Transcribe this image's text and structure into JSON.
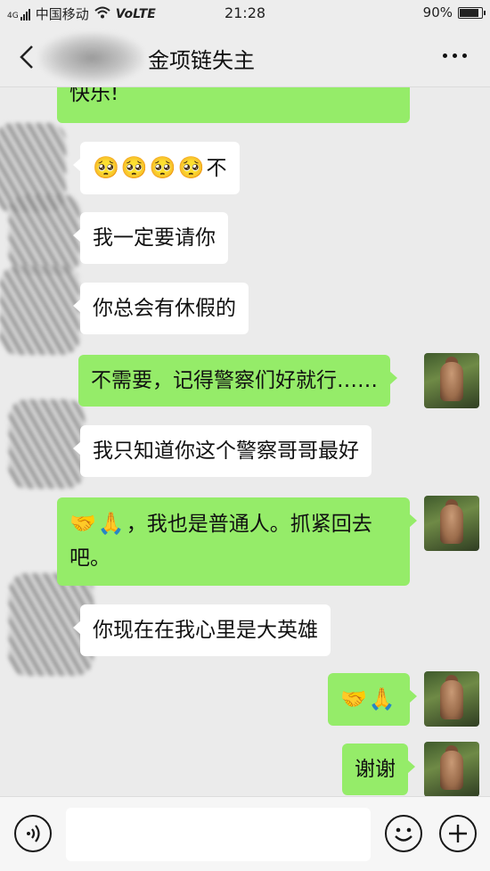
{
  "status_bar": {
    "network_type": "4G",
    "carrier": "中国移动",
    "volte": "VoLTE",
    "time": "21:28",
    "battery": "90%",
    "battery_level": 0.9
  },
  "nav": {
    "title": "金项链失主"
  },
  "messages": [
    {
      "side": "out",
      "text": "快乐!"
    },
    {
      "side": "in",
      "emoji": "🥺🥺🥺🥺",
      "text": "不"
    },
    {
      "side": "in",
      "text": "我一定要请你"
    },
    {
      "side": "in",
      "text": "你总会有休假的"
    },
    {
      "side": "out",
      "text": "不需要，记得警察们好就行……"
    },
    {
      "side": "in",
      "text": "我只知道你这个警察哥哥最好"
    },
    {
      "side": "out",
      "emoji": "🤝🙏",
      "text": "，我也是普通人。抓紧回去吧。"
    },
    {
      "side": "in",
      "text": "你现在在我心里是大英雄"
    },
    {
      "side": "out",
      "emoji": "🤝🙏",
      "text": ""
    },
    {
      "side": "out",
      "text": "谢谢"
    }
  ],
  "input_bar": {
    "voice_icon": "voice-icon",
    "emoji_icon": "emoji-icon",
    "plus_icon": "plus-icon",
    "placeholder": ""
  }
}
